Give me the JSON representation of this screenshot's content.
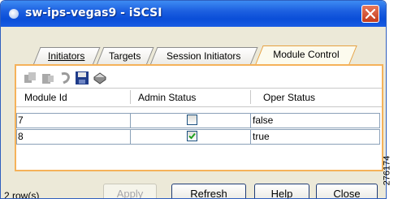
{
  "window": {
    "title": "sw-ips-vegas9 - iSCSI"
  },
  "tabs": [
    {
      "label": "Initiators"
    },
    {
      "label": "Targets"
    },
    {
      "label": "Session Initiators"
    },
    {
      "label": "Module Control",
      "active": true
    }
  ],
  "toolbar": {
    "icons": [
      "copy-icon",
      "paste-icon",
      "undo-icon",
      "save-icon",
      "print-icon"
    ]
  },
  "table": {
    "columns": [
      "Module Id",
      "Admin Status",
      "Oper Status"
    ],
    "rows": [
      {
        "module_id": "7",
        "admin_status_checked": false,
        "oper_status": "false"
      },
      {
        "module_id": "8",
        "admin_status_checked": true,
        "oper_status": "true"
      }
    ]
  },
  "buttons": {
    "apply": "Apply",
    "refresh": "Refresh",
    "help": "Help",
    "close": "Close"
  },
  "status": {
    "row_count": "2 row(s)"
  },
  "figure_code": "276174",
  "colors": {
    "titlebar": "#0a4ed8",
    "panel_border": "#f5b25a",
    "window_bg": "#ece9d8",
    "check_mark": "#21a121"
  }
}
